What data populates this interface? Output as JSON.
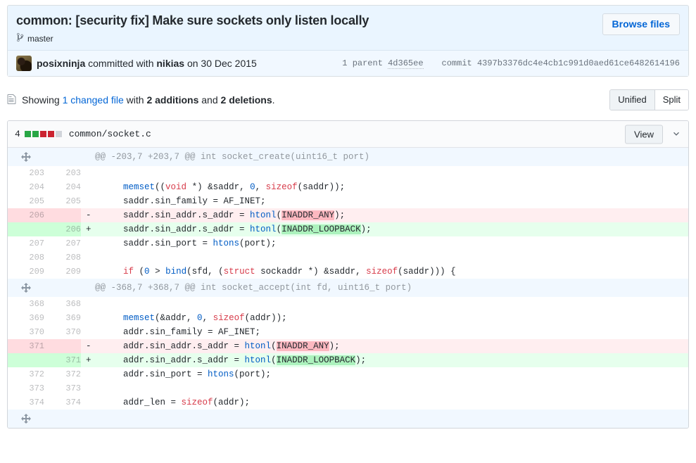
{
  "commit": {
    "title": "common: [security fix] Make sure sockets only listen locally",
    "branch": "master",
    "branch_icon": "git-branch-icon",
    "browse_files_label": "Browse files",
    "author": "posixninja",
    "committed_with_text": "committed with",
    "co_author": "nikias",
    "date_text": "on 30 Dec 2015",
    "parent_label": "1 parent",
    "parent_sha": "4d365ee",
    "commit_label": "commit",
    "commit_sha": "4397b3376dc4e4cb1c991d0aed61ce6482614196"
  },
  "showing": {
    "file_icon": "file-icon",
    "prefix": "Showing",
    "changed_file_link": "1 changed file",
    "with_text": "with",
    "additions": "2 additions",
    "and_text": "and",
    "deletions": "2 deletions",
    "period": "."
  },
  "view_toggle": {
    "unified_label": "Unified",
    "split_label": "Split",
    "active": "Unified"
  },
  "file": {
    "stat_count": "4",
    "blocks": [
      "add",
      "add",
      "del",
      "del",
      "neutral"
    ],
    "path": "common/socket.c",
    "view_label": "View",
    "chevron_icon": "chevron-down-icon"
  },
  "diff": {
    "expand_icon": "unfold-icon",
    "rows": [
      {
        "type": "hunk",
        "text": "@@ -203,7 +203,7 @@ int socket_create(uint16_t port)"
      },
      {
        "type": "ctx",
        "old": "203",
        "new": "203",
        "sign": "",
        "code": ""
      },
      {
        "type": "ctx",
        "old": "204",
        "new": "204",
        "sign": "",
        "code": "        memset((void *) &saddr, 0, sizeof(saddr));"
      },
      {
        "type": "ctx",
        "old": "205",
        "new": "205",
        "sign": "",
        "code": "        saddr.sin_family = AF_INET;"
      },
      {
        "type": "del",
        "old": "206",
        "new": "",
        "sign": "-",
        "code": "        saddr.sin_addr.s_addr = htonl(INADDR_ANY);"
      },
      {
        "type": "add",
        "old": "",
        "new": "206",
        "sign": "+",
        "code": "        saddr.sin_addr.s_addr = htonl(INADDR_LOOPBACK);"
      },
      {
        "type": "ctx",
        "old": "207",
        "new": "207",
        "sign": "",
        "code": "        saddr.sin_port = htons(port);"
      },
      {
        "type": "ctx",
        "old": "208",
        "new": "208",
        "sign": "",
        "code": ""
      },
      {
        "type": "ctx",
        "old": "209",
        "new": "209",
        "sign": "",
        "code": "        if (0 > bind(sfd, (struct sockaddr *) &saddr, sizeof(saddr))) {"
      },
      {
        "type": "hunk",
        "text": "@@ -368,7 +368,7 @@ int socket_accept(int fd, uint16_t port)"
      },
      {
        "type": "ctx",
        "old": "368",
        "new": "368",
        "sign": "",
        "code": ""
      },
      {
        "type": "ctx",
        "old": "369",
        "new": "369",
        "sign": "",
        "code": "        memset(&addr, 0, sizeof(addr));"
      },
      {
        "type": "ctx",
        "old": "370",
        "new": "370",
        "sign": "",
        "code": "        addr.sin_family = AF_INET;"
      },
      {
        "type": "del",
        "old": "371",
        "new": "",
        "sign": "-",
        "code": "        addr.sin_addr.s_addr = htonl(INADDR_ANY);"
      },
      {
        "type": "add",
        "old": "",
        "new": "371",
        "sign": "+",
        "code": "        addr.sin_addr.s_addr = htonl(INADDR_LOOPBACK);"
      },
      {
        "type": "ctx",
        "old": "372",
        "new": "372",
        "sign": "",
        "code": "        addr.sin_port = htons(port);"
      },
      {
        "type": "ctx",
        "old": "373",
        "new": "373",
        "sign": "",
        "code": ""
      },
      {
        "type": "ctx",
        "old": "374",
        "new": "374",
        "sign": "",
        "code": "        addr_len = sizeof(addr);"
      },
      {
        "type": "hunk",
        "text": ""
      }
    ]
  },
  "colors": {
    "link": "#0366d6",
    "add_bg": "#e6ffed",
    "del_bg": "#ffeef0",
    "add_hl": "#acf2bd",
    "del_hl": "#fdb8c0",
    "hunk_bg": "#f1f8ff",
    "keyword": "#d73a49",
    "identifier": "#005cc5",
    "stat_add": "#28a745",
    "stat_del": "#cb2431"
  }
}
